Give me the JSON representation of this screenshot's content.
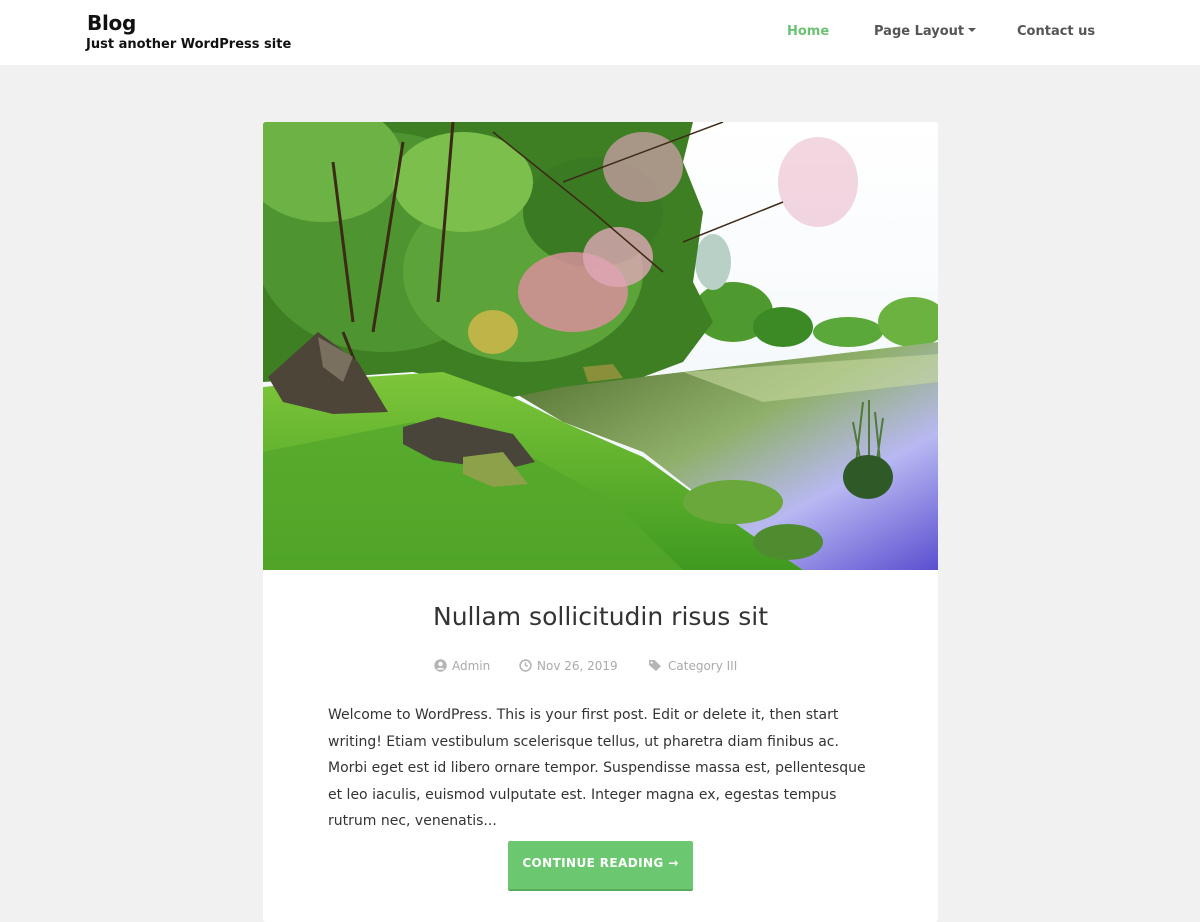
{
  "site": {
    "title": "Blog",
    "tagline": "Just another WordPress site"
  },
  "nav": {
    "items": [
      {
        "label": "Home",
        "active": true
      },
      {
        "label": "Page Layout",
        "has_dropdown": true
      },
      {
        "label": "Contact us"
      }
    ]
  },
  "post": {
    "title": "Nullam sollicitudin risus sit",
    "author": "Admin",
    "date": "Nov 26, 2019",
    "category": "Category III",
    "excerpt": "Welcome to WordPress. This is your first post. Edit or delete it, then start writing! Etiam vestibulum scelerisque tellus, ut pharetra diam finibus ac. Morbi eget est id libero ornare tempor. Suspendisse massa est, pellentesque et leo iaculis, euismod vulputate est. Integer magna ex, egestas tempus rutrum nec, venenatis...",
    "read_more": "CONTINUE READING →",
    "icons": {
      "author": "user-icon",
      "date": "clock-icon",
      "category": "tag-icon"
    }
  },
  "colors": {
    "accent": "#6cc870",
    "nav_active": "#6cc272",
    "background": "#f1f1f1"
  }
}
